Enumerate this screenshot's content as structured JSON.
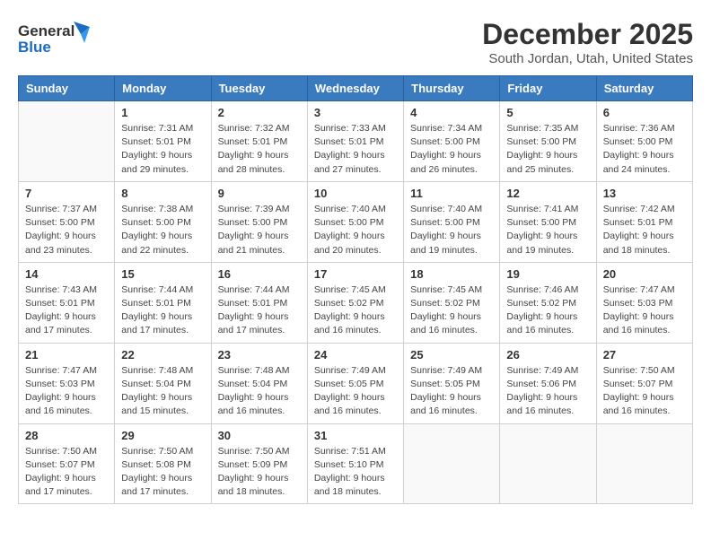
{
  "logo": {
    "line1": "General",
    "line2": "Blue"
  },
  "title": "December 2025",
  "location": "South Jordan, Utah, United States",
  "weekdays": [
    "Sunday",
    "Monday",
    "Tuesday",
    "Wednesday",
    "Thursday",
    "Friday",
    "Saturday"
  ],
  "weeks": [
    [
      {
        "day": "",
        "sunrise": "",
        "sunset": "",
        "daylight": ""
      },
      {
        "day": "1",
        "sunrise": "Sunrise: 7:31 AM",
        "sunset": "Sunset: 5:01 PM",
        "daylight": "Daylight: 9 hours and 29 minutes."
      },
      {
        "day": "2",
        "sunrise": "Sunrise: 7:32 AM",
        "sunset": "Sunset: 5:01 PM",
        "daylight": "Daylight: 9 hours and 28 minutes."
      },
      {
        "day": "3",
        "sunrise": "Sunrise: 7:33 AM",
        "sunset": "Sunset: 5:01 PM",
        "daylight": "Daylight: 9 hours and 27 minutes."
      },
      {
        "day": "4",
        "sunrise": "Sunrise: 7:34 AM",
        "sunset": "Sunset: 5:00 PM",
        "daylight": "Daylight: 9 hours and 26 minutes."
      },
      {
        "day": "5",
        "sunrise": "Sunrise: 7:35 AM",
        "sunset": "Sunset: 5:00 PM",
        "daylight": "Daylight: 9 hours and 25 minutes."
      },
      {
        "day": "6",
        "sunrise": "Sunrise: 7:36 AM",
        "sunset": "Sunset: 5:00 PM",
        "daylight": "Daylight: 9 hours and 24 minutes."
      }
    ],
    [
      {
        "day": "7",
        "sunrise": "Sunrise: 7:37 AM",
        "sunset": "Sunset: 5:00 PM",
        "daylight": "Daylight: 9 hours and 23 minutes."
      },
      {
        "day": "8",
        "sunrise": "Sunrise: 7:38 AM",
        "sunset": "Sunset: 5:00 PM",
        "daylight": "Daylight: 9 hours and 22 minutes."
      },
      {
        "day": "9",
        "sunrise": "Sunrise: 7:39 AM",
        "sunset": "Sunset: 5:00 PM",
        "daylight": "Daylight: 9 hours and 21 minutes."
      },
      {
        "day": "10",
        "sunrise": "Sunrise: 7:40 AM",
        "sunset": "Sunset: 5:00 PM",
        "daylight": "Daylight: 9 hours and 20 minutes."
      },
      {
        "day": "11",
        "sunrise": "Sunrise: 7:40 AM",
        "sunset": "Sunset: 5:00 PM",
        "daylight": "Daylight: 9 hours and 19 minutes."
      },
      {
        "day": "12",
        "sunrise": "Sunrise: 7:41 AM",
        "sunset": "Sunset: 5:00 PM",
        "daylight": "Daylight: 9 hours and 19 minutes."
      },
      {
        "day": "13",
        "sunrise": "Sunrise: 7:42 AM",
        "sunset": "Sunset: 5:01 PM",
        "daylight": "Daylight: 9 hours and 18 minutes."
      }
    ],
    [
      {
        "day": "14",
        "sunrise": "Sunrise: 7:43 AM",
        "sunset": "Sunset: 5:01 PM",
        "daylight": "Daylight: 9 hours and 17 minutes."
      },
      {
        "day": "15",
        "sunrise": "Sunrise: 7:44 AM",
        "sunset": "Sunset: 5:01 PM",
        "daylight": "Daylight: 9 hours and 17 minutes."
      },
      {
        "day": "16",
        "sunrise": "Sunrise: 7:44 AM",
        "sunset": "Sunset: 5:01 PM",
        "daylight": "Daylight: 9 hours and 17 minutes."
      },
      {
        "day": "17",
        "sunrise": "Sunrise: 7:45 AM",
        "sunset": "Sunset: 5:02 PM",
        "daylight": "Daylight: 9 hours and 16 minutes."
      },
      {
        "day": "18",
        "sunrise": "Sunrise: 7:45 AM",
        "sunset": "Sunset: 5:02 PM",
        "daylight": "Daylight: 9 hours and 16 minutes."
      },
      {
        "day": "19",
        "sunrise": "Sunrise: 7:46 AM",
        "sunset": "Sunset: 5:02 PM",
        "daylight": "Daylight: 9 hours and 16 minutes."
      },
      {
        "day": "20",
        "sunrise": "Sunrise: 7:47 AM",
        "sunset": "Sunset: 5:03 PM",
        "daylight": "Daylight: 9 hours and 16 minutes."
      }
    ],
    [
      {
        "day": "21",
        "sunrise": "Sunrise: 7:47 AM",
        "sunset": "Sunset: 5:03 PM",
        "daylight": "Daylight: 9 hours and 16 minutes."
      },
      {
        "day": "22",
        "sunrise": "Sunrise: 7:48 AM",
        "sunset": "Sunset: 5:04 PM",
        "daylight": "Daylight: 9 hours and 15 minutes."
      },
      {
        "day": "23",
        "sunrise": "Sunrise: 7:48 AM",
        "sunset": "Sunset: 5:04 PM",
        "daylight": "Daylight: 9 hours and 16 minutes."
      },
      {
        "day": "24",
        "sunrise": "Sunrise: 7:49 AM",
        "sunset": "Sunset: 5:05 PM",
        "daylight": "Daylight: 9 hours and 16 minutes."
      },
      {
        "day": "25",
        "sunrise": "Sunrise: 7:49 AM",
        "sunset": "Sunset: 5:05 PM",
        "daylight": "Daylight: 9 hours and 16 minutes."
      },
      {
        "day": "26",
        "sunrise": "Sunrise: 7:49 AM",
        "sunset": "Sunset: 5:06 PM",
        "daylight": "Daylight: 9 hours and 16 minutes."
      },
      {
        "day": "27",
        "sunrise": "Sunrise: 7:50 AM",
        "sunset": "Sunset: 5:07 PM",
        "daylight": "Daylight: 9 hours and 16 minutes."
      }
    ],
    [
      {
        "day": "28",
        "sunrise": "Sunrise: 7:50 AM",
        "sunset": "Sunset: 5:07 PM",
        "daylight": "Daylight: 9 hours and 17 minutes."
      },
      {
        "day": "29",
        "sunrise": "Sunrise: 7:50 AM",
        "sunset": "Sunset: 5:08 PM",
        "daylight": "Daylight: 9 hours and 17 minutes."
      },
      {
        "day": "30",
        "sunrise": "Sunrise: 7:50 AM",
        "sunset": "Sunset: 5:09 PM",
        "daylight": "Daylight: 9 hours and 18 minutes."
      },
      {
        "day": "31",
        "sunrise": "Sunrise: 7:51 AM",
        "sunset": "Sunset: 5:10 PM",
        "daylight": "Daylight: 9 hours and 18 minutes."
      },
      {
        "day": "",
        "sunrise": "",
        "sunset": "",
        "daylight": ""
      },
      {
        "day": "",
        "sunrise": "",
        "sunset": "",
        "daylight": ""
      },
      {
        "day": "",
        "sunrise": "",
        "sunset": "",
        "daylight": ""
      }
    ]
  ]
}
